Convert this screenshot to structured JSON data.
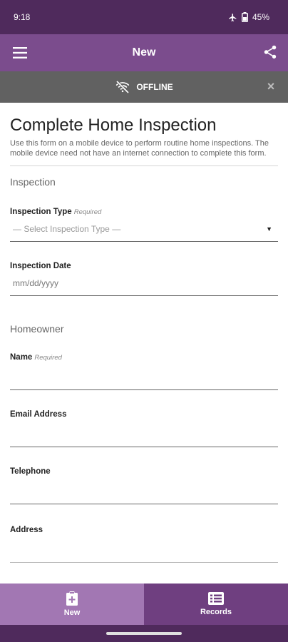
{
  "status_bar": {
    "time": "9:18",
    "battery": "45%",
    "icons": [
      "airplane-icon",
      "battery-icon"
    ]
  },
  "app_bar": {
    "title": "New",
    "left_icon": "menu-icon",
    "right_icon": "share-icon"
  },
  "offline_banner": {
    "label": "OFFLINE",
    "icon": "wifi-off-icon",
    "close": "×"
  },
  "form": {
    "title": "Complete Home Inspection",
    "description": "Use this form on a mobile device to perform routine home inspections. The mobile device need not have an internet connection to complete this form.",
    "sections": [
      {
        "title": "Inspection",
        "fields": [
          {
            "label": "Inspection Type",
            "required": "Required",
            "value": "— Select Inspection Type —"
          },
          {
            "label": "Inspection Date",
            "placeholder": "mm/dd/yyyy"
          }
        ]
      },
      {
        "title": "Homeowner",
        "fields": [
          {
            "label": "Name",
            "required": "Required"
          },
          {
            "label": "Email Address"
          },
          {
            "label": "Telephone"
          },
          {
            "label": "Address"
          }
        ]
      }
    ]
  },
  "bottom_nav": {
    "tabs": [
      {
        "label": "New",
        "icon": "clipboard-plus-icon",
        "active": true
      },
      {
        "label": "Records",
        "icon": "list-icon",
        "active": false
      }
    ]
  },
  "colors": {
    "status_bar": "#4f2a5c",
    "app_bar": "#7b4c8d",
    "offline_bar": "#616161",
    "nav_active": "#a277b3",
    "nav_inactive": "#6f3f80"
  }
}
